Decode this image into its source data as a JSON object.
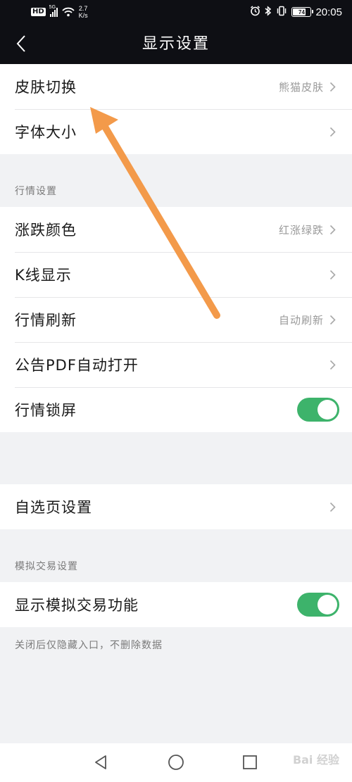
{
  "status_bar": {
    "network_badge": "HD",
    "signal_label": "5G",
    "speed_value": "2.7",
    "speed_unit": "K/s",
    "battery_percent": "74",
    "battery_level": 0.74,
    "time": "20:05",
    "icons": [
      "signal-icon",
      "wifi-icon",
      "alarm-icon",
      "bluetooth-icon",
      "vibrate-icon",
      "battery-icon"
    ]
  },
  "header": {
    "title": "显示设置",
    "back_icon": "chevron-left-icon"
  },
  "group1": [
    {
      "label": "皮肤切换",
      "value": "熊猫皮肤"
    },
    {
      "label": "字体大小",
      "value": ""
    }
  ],
  "section_market": {
    "label": "行情设置",
    "rows": [
      {
        "label": "涨跌颜色",
        "value": "红涨绿跌"
      },
      {
        "label": "K线显示",
        "value": ""
      },
      {
        "label": "行情刷新",
        "value": "自动刷新"
      },
      {
        "label": "公告PDF自动打开",
        "value": ""
      },
      {
        "label": "行情锁屏",
        "toggle": true
      }
    ]
  },
  "group_watchlist": {
    "label": "自选页设置"
  },
  "section_sim": {
    "label": "模拟交易设置",
    "row_label": "显示模拟交易功能",
    "toggle": true,
    "hint": "关闭后仅隐藏入口，不删除数据"
  },
  "nav": {
    "icons": [
      "back-triangle-icon",
      "home-circle-icon",
      "recents-square-icon"
    ]
  },
  "watermark": "Bai 经验",
  "colors": {
    "header_bg": "#0e0f14",
    "toggle_on": "#3db36b",
    "page_bg": "#f1f2f4",
    "annotation_arrow": "#f39a4a"
  }
}
